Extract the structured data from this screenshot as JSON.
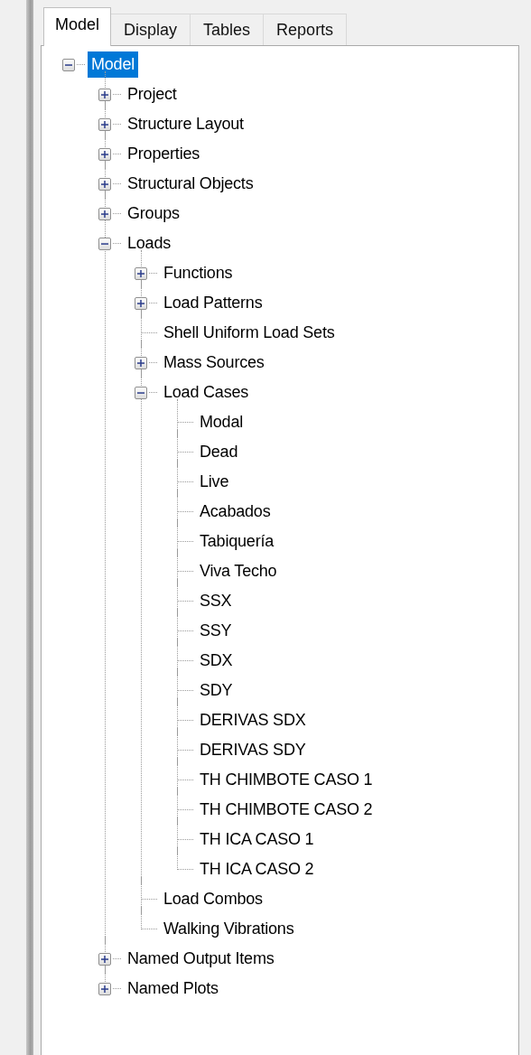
{
  "tabs": [
    {
      "label": "Model",
      "selected": true
    },
    {
      "label": "Display",
      "selected": false
    },
    {
      "label": "Tables",
      "selected": false
    },
    {
      "label": "Reports",
      "selected": false
    }
  ],
  "tree": [
    {
      "label": "Model",
      "selected": true,
      "expanded": true,
      "children": [
        {
          "label": "Project",
          "selected": false,
          "expanded": false
        },
        {
          "label": "Structure Layout",
          "selected": false,
          "expanded": false
        },
        {
          "label": "Properties",
          "selected": false,
          "expanded": false
        },
        {
          "label": "Structural Objects",
          "selected": false,
          "expanded": false
        },
        {
          "label": "Groups",
          "selected": false,
          "expanded": false
        },
        {
          "label": "Loads",
          "selected": false,
          "expanded": true,
          "children": [
            {
              "label": "Functions",
              "selected": false,
              "expanded": false
            },
            {
              "label": "Load Patterns",
              "selected": false,
              "expanded": false
            },
            {
              "label": "Shell Uniform Load Sets",
              "selected": false
            },
            {
              "label": "Mass Sources",
              "selected": false,
              "expanded": false
            },
            {
              "label": "Load Cases",
              "selected": false,
              "expanded": true,
              "children": [
                {
                  "label": "Modal",
                  "selected": false
                },
                {
                  "label": "Dead",
                  "selected": false
                },
                {
                  "label": "Live",
                  "selected": false
                },
                {
                  "label": "Acabados",
                  "selected": false
                },
                {
                  "label": "Tabiquería",
                  "selected": false
                },
                {
                  "label": "Viva Techo",
                  "selected": false
                },
                {
                  "label": "SSX",
                  "selected": false
                },
                {
                  "label": "SSY",
                  "selected": false
                },
                {
                  "label": "SDX",
                  "selected": false
                },
                {
                  "label": "SDY",
                  "selected": false
                },
                {
                  "label": "DERIVAS SDX",
                  "selected": false
                },
                {
                  "label": "DERIVAS SDY",
                  "selected": false
                },
                {
                  "label": "TH CHIMBOTE CASO 1",
                  "selected": false
                },
                {
                  "label": "TH CHIMBOTE CASO 2",
                  "selected": false
                },
                {
                  "label": "TH ICA CASO 1",
                  "selected": false
                },
                {
                  "label": "TH ICA CASO 2",
                  "selected": false
                }
              ]
            },
            {
              "label": "Load Combos",
              "selected": false
            },
            {
              "label": "Walking Vibrations",
              "selected": false
            }
          ]
        },
        {
          "label": "Named Output Items",
          "selected": false,
          "expanded": false
        },
        {
          "label": "Named Plots",
          "selected": false,
          "expanded": false
        }
      ]
    }
  ]
}
